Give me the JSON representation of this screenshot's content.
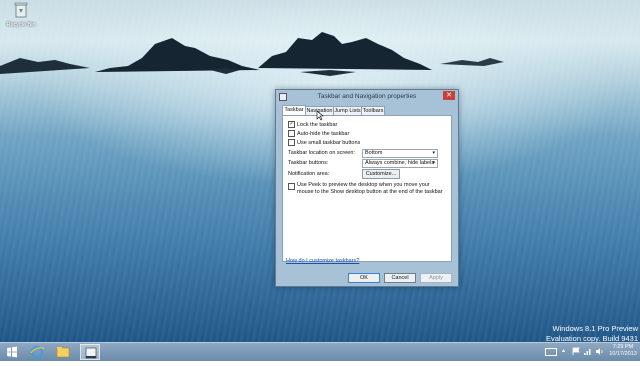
{
  "desktop": {
    "recycle_bin_label": "Recycle Bin",
    "watermark": {
      "line1": "Windows 8.1 Pro Preview",
      "line2": "Evaluation copy. Build 9431"
    }
  },
  "dialog": {
    "title": "Taskbar and Navigation properties",
    "tabs": [
      {
        "label": "Taskbar",
        "active": true
      },
      {
        "label": "Navigation",
        "active": false
      },
      {
        "label": "Jump Lists",
        "active": false
      },
      {
        "label": "Toolbars",
        "active": false
      }
    ],
    "checkboxes": {
      "lock": {
        "label": "Lock the taskbar",
        "checked": true
      },
      "autohide": {
        "label": "Auto-hide the taskbar",
        "checked": false
      },
      "small": {
        "label": "Use small taskbar buttons",
        "checked": false
      }
    },
    "location_label": "Taskbar location on screen:",
    "location_value": "Bottom",
    "buttons_label": "Taskbar buttons:",
    "buttons_value": "Always combine, hide labels",
    "notification_label": "Notification area:",
    "customize_label": "Customize...",
    "peek": {
      "label": "Use Peek to preview the desktop when you move your mouse to the Show desktop button at the end of the taskbar",
      "checked": false
    },
    "help_link": "How do I customize taskbars?",
    "ok_label": "OK",
    "cancel_label": "Cancel",
    "apply_label": "Apply",
    "close_glyph": "✕"
  },
  "taskbar": {
    "items": [
      "windows-icon",
      "internet-explorer-icon",
      "file-explorer-icon",
      "taskbar-properties-icon"
    ],
    "tray": [
      "keyboard-icon",
      "show-hidden-icon",
      "flag-icon",
      "network-icon",
      "volume-icon"
    ],
    "time": "7:29 PM",
    "date": "10/17/2013"
  }
}
